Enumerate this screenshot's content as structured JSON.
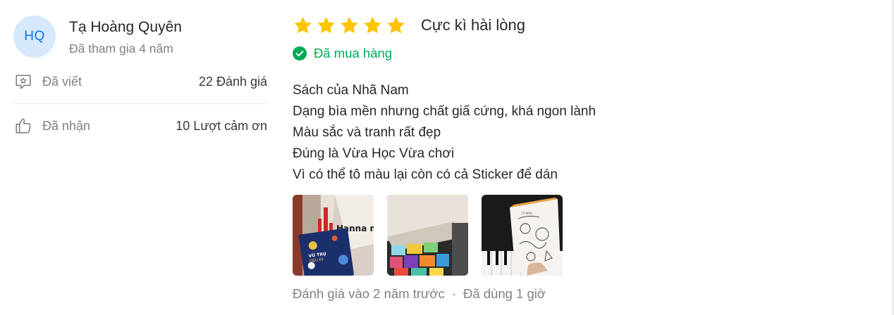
{
  "reviewer": {
    "initials": "HQ",
    "name": "Tạ Hoàng Quyên",
    "joined": "Đã tham gia 4 năm",
    "stats": [
      {
        "label": "Đã viết",
        "value": "22 Đánh giá",
        "icon": "comment-star-icon"
      },
      {
        "label": "Đã nhận",
        "value": "10 Lượt cảm ơn",
        "icon": "thumbs-up-icon"
      }
    ]
  },
  "review": {
    "rating": 5,
    "rating_max": 5,
    "rating_title": "Cực kì hài lòng",
    "verified_label": "Đã mua hàng",
    "lines": [
      "Sách của Nhã Nam",
      "Dạng bìa mền nhưng chất giấ cứng, khá ngon lành",
      "Màu sắc và tranh rất đẹp",
      "Đúng là Vừa Học Vừa chơi",
      "Vì có thể tô màu lại còn có cả Sticker để dán"
    ],
    "photos": [
      {
        "sign_text": "Hanna music",
        "book_title": "VŨ TRỤ DIỆU KỲ"
      },
      {
        "sign_text": ""
      },
      {
        "sign_text": ""
      }
    ],
    "reviewed_time": "Đánh giá vào 2 năm trước",
    "separator": "·",
    "usage_time": "Đã dùng 1 giờ"
  },
  "colors": {
    "star": "#ffc400",
    "verified": "#00ab56",
    "avatar_bg": "#d6e8fb",
    "avatar_text": "#0b74e5",
    "muted_text": "#808089"
  }
}
